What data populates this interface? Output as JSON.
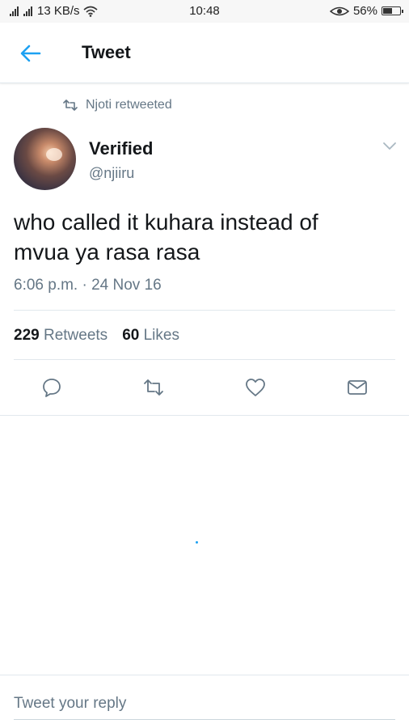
{
  "status_bar": {
    "network_speed": "13 KB/s",
    "time": "10:48",
    "battery": "56%",
    "battery_level": 0.56,
    "icons": [
      "signal-icon",
      "wifi-icon",
      "eye-icon",
      "battery-icon"
    ]
  },
  "header": {
    "back_icon": "arrow-left-icon",
    "title": "Tweet"
  },
  "tweet": {
    "retweet_note": "Njoti retweeted",
    "author_name": "Verified",
    "author_handle": "@njiiru",
    "text_line1": "who called it kuhara instead of",
    "text_line2": "mvua ya rasa rasa",
    "timestamp": "6:06 p.m. · 24 Nov 16",
    "retweet_count": "229",
    "retweet_label": "Retweets",
    "like_count": "60",
    "like_label": "Likes"
  },
  "actions": [
    "reply-icon",
    "retweet-icon",
    "like-icon",
    "message-icon"
  ],
  "reply": {
    "placeholder": "Tweet your reply"
  },
  "colors": {
    "accent": "#1da1f2",
    "text_primary": "#14171a",
    "text_secondary": "#657786",
    "divider": "#e1e8ed"
  }
}
